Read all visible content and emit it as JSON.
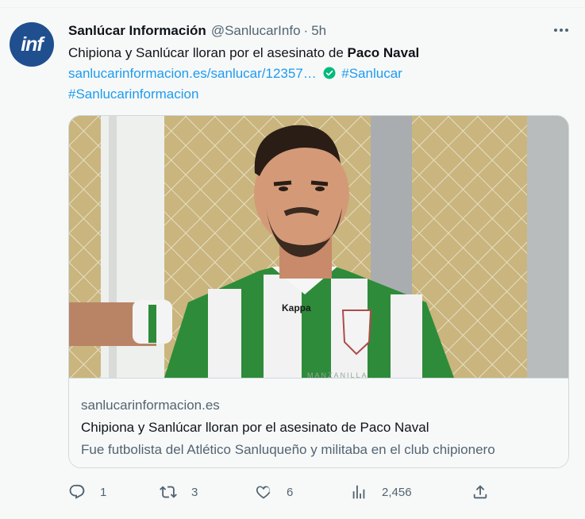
{
  "author": {
    "avatar_text": "inf",
    "name": "Sanlúcar Información",
    "handle": "@SanlucarInfo",
    "separator": "·",
    "time": "5h"
  },
  "tweet": {
    "text_prefix": "Chipiona y Sanlúcar lloran por el asesinato de ",
    "text_bold": "Paco Naval",
    "link": "sanlucarinformacion.es/sanlucar/12357…",
    "hashtag_1": "#Sanlucar",
    "hashtag_2": "#Sanlucarinformacion"
  },
  "card": {
    "jersey_brand": "Kappa",
    "jersey_sponsor": "MANZANILLA",
    "domain": "sanlucarinformacion.es",
    "title": "Chipiona y Sanlúcar lloran por el asesinato de Paco Naval",
    "description": "Fue futbolista del Atlético Sanluqueño y militaba en el club chipionero"
  },
  "actions": {
    "replies": "1",
    "reposts": "3",
    "likes": "6",
    "views": "2,456"
  },
  "icons": {
    "reply": "reply-icon",
    "repost": "repost-icon",
    "like": "heart-icon",
    "views": "analytics-icon",
    "share": "share-icon",
    "more": "more-icon",
    "verified": "verified-icon"
  },
  "colors": {
    "link": "#1d9bf0",
    "verified": "#00ba7c",
    "muted": "#536471",
    "avatar_bg": "#1f4f8f",
    "jersey_green": "#2e8b3a"
  }
}
